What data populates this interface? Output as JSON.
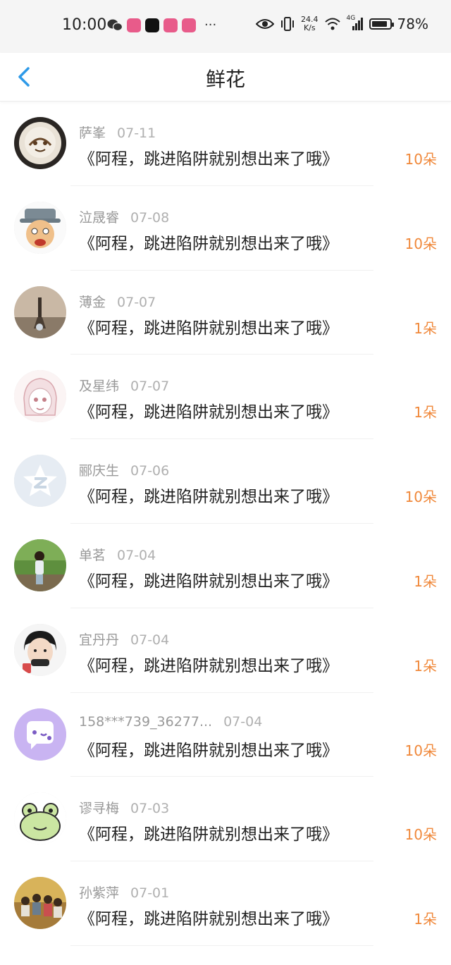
{
  "status_bar": {
    "time": "10:00",
    "speed_value": "24.4",
    "speed_unit": "K/s",
    "network": "4G",
    "battery": "78%",
    "more": "···"
  },
  "nav": {
    "title": "鲜花",
    "back_icon": "chevron-left-icon",
    "accent_color": "#2e9ae8"
  },
  "colors": {
    "count": "#f0883a",
    "meta": "#999999"
  },
  "items": [
    {
      "name": "萨峯",
      "date": "07-11",
      "title": "《阿程，跳进陷阱就别想出来了哦》",
      "count": "10朵",
      "avatar": "latte-art"
    },
    {
      "name": "泣晟睿",
      "date": "07-08",
      "title": "《阿程，跳进陷阱就别想出来了哦》",
      "count": "10朵",
      "avatar": "cartoon-old-man"
    },
    {
      "name": "薄金",
      "date": "07-07",
      "title": "《阿程，跳进陷阱就别想出来了哦》",
      "count": "1朵",
      "avatar": "tower-photo"
    },
    {
      "name": "及星纬",
      "date": "07-07",
      "title": "《阿程，跳进陷阱就别想出来了哦》",
      "count": "1朵",
      "avatar": "anime-girl-sketch"
    },
    {
      "name": "郦庆生",
      "date": "07-06",
      "title": "《阿程，跳进陷阱就别想出来了哦》",
      "count": "10朵",
      "avatar": "default-star-logo"
    },
    {
      "name": "单茗",
      "date": "07-04",
      "title": "《阿程，跳进陷阱就别想出来了哦》",
      "count": "1朵",
      "avatar": "girl-in-park"
    },
    {
      "name": "宜丹丹",
      "date": "07-04",
      "title": "《阿程，跳进陷阱就别想出来了哦》",
      "count": "1朵",
      "avatar": "boy-portrait"
    },
    {
      "name": "158***739_36277...",
      "date": "07-04",
      "title": "《阿程，跳进陷阱就别想出来了哦》",
      "count": "10朵",
      "avatar": "chat-bubble-logo"
    },
    {
      "name": "谬寻梅",
      "date": "07-03",
      "title": "《阿程，跳进陷阱就别想出来了哦》",
      "count": "10朵",
      "avatar": "cartoon-frog"
    },
    {
      "name": "孙紫萍",
      "date": "07-01",
      "title": "《阿程，跳进陷阱就别想出来了哦》",
      "count": "1朵",
      "avatar": "group-photo"
    }
  ]
}
